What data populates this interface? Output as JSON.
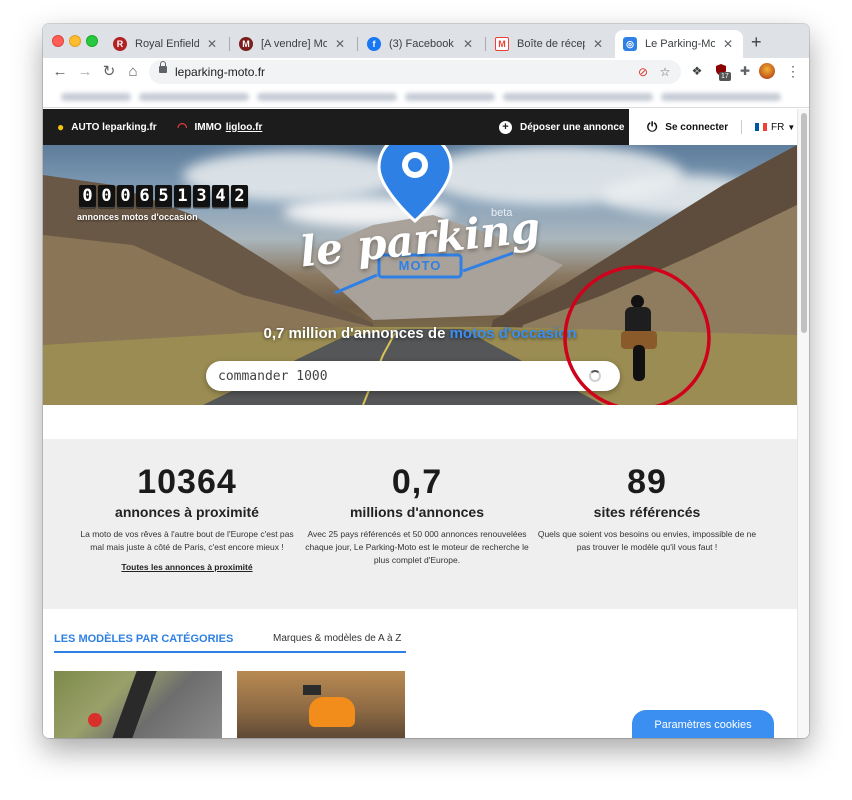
{
  "browser": {
    "tabs": [
      {
        "title": "Royal Enfield le Shop",
        "icon": "royal-enfield-icon",
        "color": "#b22222"
      },
      {
        "title": "[A vendre] Moto Guzzi",
        "icon": "motorcycle-icon",
        "color": "#7a1e1e"
      },
      {
        "title": "(3) Facebook",
        "icon": "facebook-icon",
        "color": "#1877f2"
      },
      {
        "title": "Boîte de réception",
        "icon": "gmail-icon",
        "color": "#ea4335"
      },
      {
        "title": "Le Parking-Moto",
        "icon": "leparking-icon",
        "color": "#2f80e4"
      }
    ],
    "new_tab": "+",
    "url": "leparking-moto.fr",
    "ext_badge": "17"
  },
  "site": {
    "auto_label": "AUTO leparking.fr",
    "immo_label": "IMMO",
    "immo_link": "ligloo.fr",
    "post_ad": "Déposer une annonce",
    "login": "Se connecter",
    "lang": "FR"
  },
  "hero": {
    "counter": [
      "0",
      "0",
      "0",
      "6",
      "5",
      "1",
      "3",
      "4",
      "2"
    ],
    "counter_label": "annonces motos d'occasion",
    "logo_text": "le parking",
    "logo_sub": "MOTO",
    "beta": "beta",
    "tagline_prefix": "0,7 million d'annonces de ",
    "tagline_highlight": "motos d'occasion",
    "search_value": "commander 1000"
  },
  "stats": [
    {
      "num": "10364",
      "label": "annonces à proximité",
      "desc": "La moto de vos rêves à l'autre bout de l'Europe c'est pas mal mais juste à côté de Paris, c'est encore mieux !",
      "link": "Toutes les annonces à proximité"
    },
    {
      "num": "0,7",
      "label": "millions d'annonces",
      "desc": "Avec 25 pays référencés et 50 000 annonces renouvelées chaque jour, Le Parking-Moto est le moteur de recherche le plus complet d'Europe.",
      "link": ""
    },
    {
      "num": "89",
      "label": "sites référencés",
      "desc": "Quels que soient vos besoins ou envies, impossible de ne pas trouver le modèle qu'il vous faut !",
      "link": ""
    }
  ],
  "categories": {
    "title": "LES MODÈLES PAR CATÉGORIES",
    "az": "Marques & modèles de A à Z"
  },
  "cookies": "Paramètres cookies",
  "colors": {
    "accent": "#2f80e4",
    "annotation": "#d0021b",
    "dark_bar": "#1c1c1c"
  }
}
